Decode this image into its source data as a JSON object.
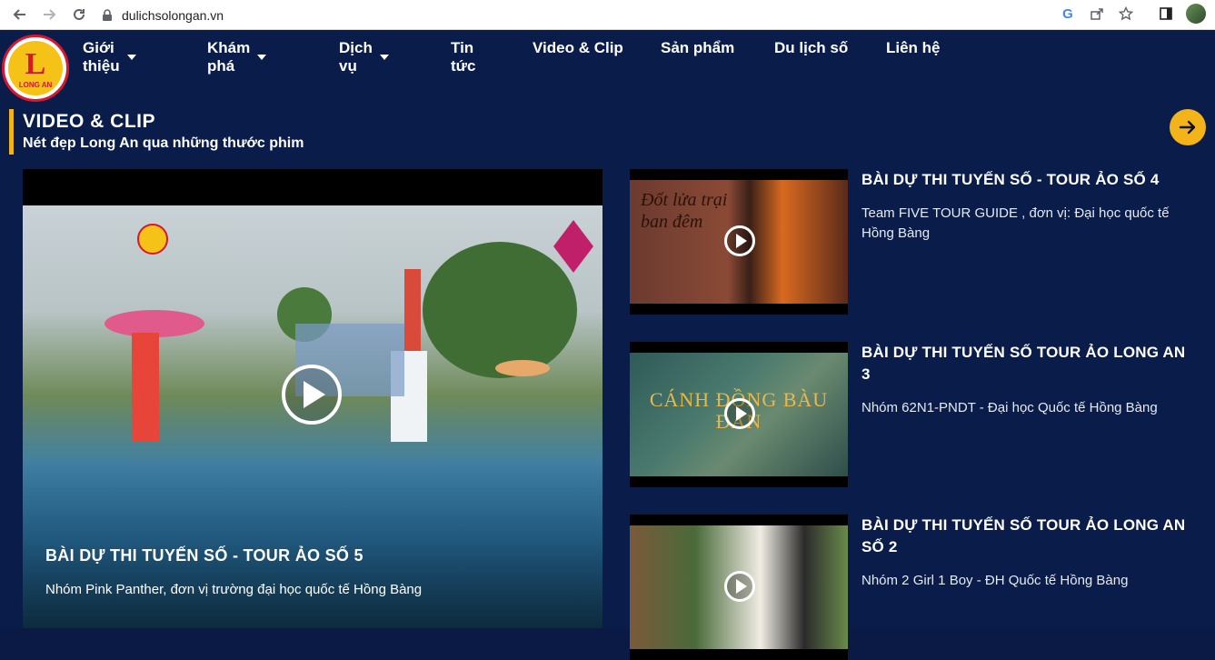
{
  "browser": {
    "url": "dulichsolongan.vn"
  },
  "logo": {
    "text": "LONG AN"
  },
  "nav": {
    "items": [
      {
        "label": "Giới thiệu",
        "dropdown": true
      },
      {
        "label": "Khám phá",
        "dropdown": true
      },
      {
        "label": "Dịch vụ",
        "dropdown": true
      },
      {
        "label": "Tin tức",
        "dropdown": false
      },
      {
        "label": "Video & Clip",
        "dropdown": false
      },
      {
        "label": "Sản phẩm",
        "dropdown": false
      },
      {
        "label": "Du lịch số",
        "dropdown": false
      },
      {
        "label": "Liên hệ",
        "dropdown": false
      }
    ]
  },
  "section": {
    "title": "VIDEO & CLIP",
    "subtitle": "Nét đẹp Long An qua những thước phim"
  },
  "featured": {
    "title": "BÀI DỰ THI TUYẾN SỐ - TOUR ẢO SỐ 5",
    "description": "Nhóm Pink Panther, đơn vị trường đại học quốc tế Hồng Bàng"
  },
  "videos": [
    {
      "title": "BÀI DỰ THI TUYẾN SỐ - TOUR ẢO SỐ 4",
      "description": "Team FIVE TOUR GUIDE , đơn vị: Đại học quốc tế Hồng Bàng",
      "thumb_text": "Đốt lửa trại ban đêm"
    },
    {
      "title": "BÀI DỰ THI TUYẾN SỐ TOUR ẢO LONG AN 3",
      "description": "Nhóm 62N1-PNDT - Đại học Quốc tế Hồng Bàng",
      "thumb_text": "CÁNH ĐỒNG BÀU ĐÀN"
    },
    {
      "title": "BÀI DỰ THI TUYẾN SỐ TOUR ẢO LONG AN SỐ 2",
      "description": "Nhóm 2 Girl 1 Boy - ĐH Quốc tế Hồng Bàng",
      "thumb_text": ""
    }
  ],
  "colors": {
    "page_bg": "#0a1d4a",
    "accent": "#f2b418",
    "brand_red": "#d7172f"
  }
}
